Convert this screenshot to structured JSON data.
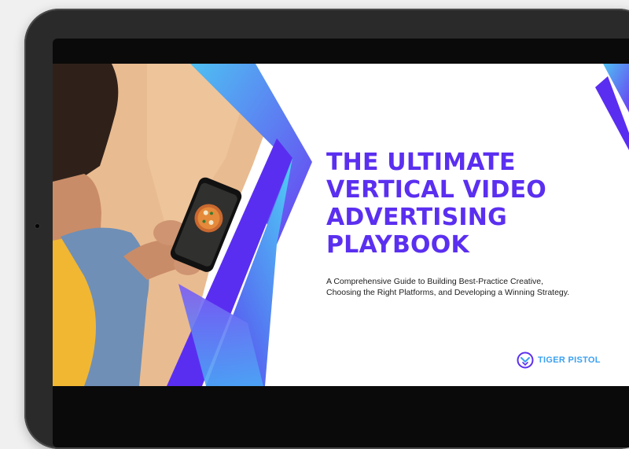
{
  "cover": {
    "title_lines": [
      "THE ULTIMATE",
      "VERTICAL VIDEO",
      "ADVERTISING",
      "PLAYBOOK"
    ],
    "subtitle_lines": [
      "A Comprehensive Guide to Building Best-Practice Creative,",
      "Choosing the Right Platforms, and Developing a Winning Strategy."
    ],
    "brand_name": "TIGER PISTOL"
  },
  "icons": {
    "brand_logo": "tiger-pistol-logo-icon",
    "camera": "front-camera-icon"
  },
  "colors": {
    "title": "#5b2ff0",
    "accent_blue": "#3aa0f0",
    "accent_purple": "#5b2ff0",
    "photo_background": "#e9bb90",
    "device_frame": "#2a2a2a"
  }
}
